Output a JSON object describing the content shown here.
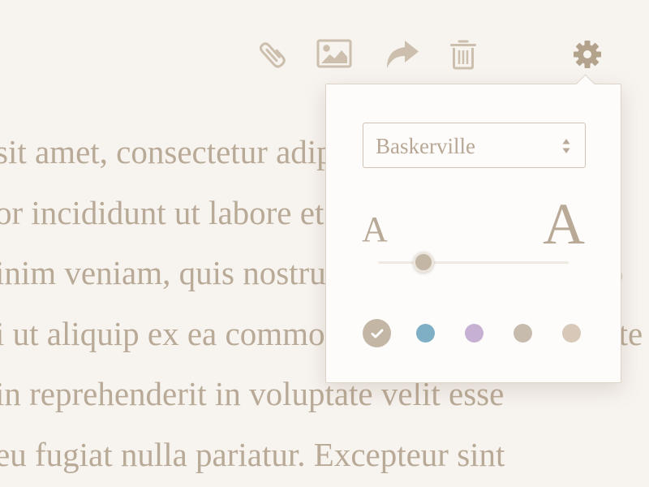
{
  "toolbar": {
    "tools": [
      {
        "name": "attach",
        "icon": "paperclip-icon"
      },
      {
        "name": "insert-image",
        "icon": "image-icon"
      },
      {
        "name": "share",
        "icon": "share-arrow-icon"
      },
      {
        "name": "delete",
        "icon": "trash-icon"
      },
      {
        "name": "settings",
        "icon": "gear-icon"
      }
    ]
  },
  "document": {
    "lines": [
      "sit amet, consectetur adipiscing elit, sed do",
      "or incididunt ut labore et dolore magna aliqua.",
      "inim veniam, quis nostrud exercitation ullamco",
      "i ut aliquip ex ea commodo consequat. Duis aute",
      "in reprehenderit in voluptate velit esse",
      "eu fugiat nulla pariatur. Excepteur sint"
    ]
  },
  "settings_popover": {
    "font_select": {
      "value": "Baskerville"
    },
    "font_size": {
      "small_label": "A",
      "large_label": "A",
      "level": 0.24
    },
    "themes": [
      {
        "name": "beige",
        "color": "#c4b6a5",
        "selected": true
      },
      {
        "name": "blue",
        "color": "#7fafc4",
        "selected": false
      },
      {
        "name": "lavender",
        "color": "#c7b1d3",
        "selected": false
      },
      {
        "name": "taupe",
        "color": "#c6bbad",
        "selected": false
      },
      {
        "name": "sand",
        "color": "#d7c8b8",
        "selected": false
      }
    ]
  },
  "colors": {
    "background": "#f7f3ef",
    "text": "#b9aa97",
    "icon": "#cdbfae",
    "settings_icon": "#b3a28c",
    "popover_background": "#fdfcfb",
    "popover_border": "#ddd4c9"
  }
}
